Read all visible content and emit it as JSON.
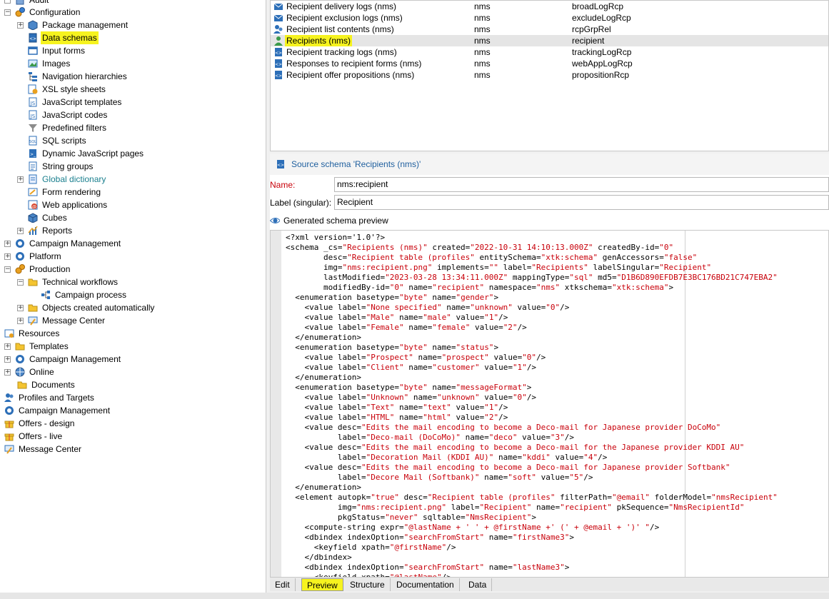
{
  "tree": {
    "items": [
      {
        "label": "Audit",
        "icon": "audit-icon"
      },
      {
        "label": "Configuration",
        "icon": "gears-icon"
      },
      {
        "label": "Package management",
        "icon": "package-icon"
      },
      {
        "label": "Data schemas",
        "icon": "schema-icon"
      },
      {
        "label": "Input forms",
        "icon": "form-icon"
      },
      {
        "label": "Images",
        "icon": "image-icon"
      },
      {
        "label": "Navigation hierarchies",
        "icon": "hierarchy-icon"
      },
      {
        "label": "XSL style sheets",
        "icon": "xsl-icon"
      },
      {
        "label": "JavaScript templates",
        "icon": "js-template-icon"
      },
      {
        "label": "JavaScript codes",
        "icon": "js-code-icon"
      },
      {
        "label": "Predefined filters",
        "icon": "filter-icon"
      },
      {
        "label": "SQL scripts",
        "icon": "sql-icon"
      },
      {
        "label": "Dynamic JavaScript pages",
        "icon": "js-page-icon"
      },
      {
        "label": "String groups",
        "icon": "string-group-icon"
      },
      {
        "label": "Global dictionary",
        "icon": "dictionary-icon"
      },
      {
        "label": "Form rendering",
        "icon": "form-rendering-icon"
      },
      {
        "label": "Web applications",
        "icon": "web-app-icon"
      },
      {
        "label": "Cubes",
        "icon": "cube-icon"
      },
      {
        "label": "Reports",
        "icon": "report-icon"
      },
      {
        "label": "Campaign Management",
        "icon": "campaign-icon"
      },
      {
        "label": "Platform",
        "icon": "platform-icon"
      },
      {
        "label": "Production",
        "icon": "production-icon"
      },
      {
        "label": "Technical workflows",
        "icon": "folder-icon"
      },
      {
        "label": "Campaign process",
        "icon": "workflow-icon"
      },
      {
        "label": "Objects created automatically",
        "icon": "folder-icon"
      },
      {
        "label": "Message Center",
        "icon": "message-center-icon"
      },
      {
        "label": "Resources",
        "icon": "resources-icon"
      },
      {
        "label": "Templates",
        "icon": "folder-icon"
      },
      {
        "label": "Campaign Management",
        "icon": "campaign-icon"
      },
      {
        "label": "Online",
        "icon": "online-icon"
      },
      {
        "label": "Documents",
        "icon": "documents-icon"
      },
      {
        "label": "Profiles and Targets",
        "icon": "profiles-icon"
      },
      {
        "label": "Campaign Management",
        "icon": "campaign-icon"
      },
      {
        "label": "Offers - design",
        "icon": "offer-icon"
      },
      {
        "label": "Offers - live",
        "icon": "offer-icon"
      },
      {
        "label": "Message Center",
        "icon": "message-center-icon"
      }
    ]
  },
  "list": {
    "rows": [
      {
        "name": "Recipient delivery logs (nms)",
        "ns": "nms",
        "internal": "broadLogRcp",
        "icon": "delivery-log-icon"
      },
      {
        "name": "Recipient exclusion logs (nms)",
        "ns": "nms",
        "internal": "excludeLogRcp",
        "icon": "exclusion-log-icon"
      },
      {
        "name": "Recipient list contents (nms)",
        "ns": "nms",
        "internal": "rcpGrpRel",
        "icon": "list-content-icon"
      },
      {
        "name": "Recipients (nms)",
        "ns": "nms",
        "internal": "recipient",
        "icon": "recipient-icon"
      },
      {
        "name": "Recipient tracking logs (nms)",
        "ns": "nms",
        "internal": "trackingLogRcp",
        "icon": "schema-icon"
      },
      {
        "name": "Responses to recipient forms (nms)",
        "ns": "nms",
        "internal": "webAppLogRcp",
        "icon": "schema-icon"
      },
      {
        "name": "Recipient offer propositions (nms)",
        "ns": "nms",
        "internal": "propositionRcp",
        "icon": "schema-icon"
      }
    ]
  },
  "source": {
    "header": "Source schema 'Recipients (nms)'",
    "name_label": "Name:",
    "name_value": "nms:recipient",
    "label_label": "Label (singular):",
    "label_value": "Recipient",
    "preview_label": "Generated schema preview"
  },
  "code_lines": [
    [
      [
        "pi",
        "<?xml version='1.0'?>"
      ]
    ],
    [
      [
        "t",
        "<schema "
      ],
      [
        "a",
        "_cs="
      ],
      [
        "v",
        "\"Recipients (nms)\""
      ],
      [
        "a",
        " created="
      ],
      [
        "v",
        "\"2022-10-31 14:10:13.000Z\""
      ],
      [
        "a",
        " createdBy-id="
      ],
      [
        "v",
        "\"0\""
      ]
    ],
    [
      [
        "a",
        "        desc="
      ],
      [
        "v",
        "\"Recipient table (profiles\""
      ],
      [
        "a",
        " entitySchema="
      ],
      [
        "v",
        "\"xtk:schema\""
      ],
      [
        "a",
        " genAccessors="
      ],
      [
        "v",
        "\"false\""
      ]
    ],
    [
      [
        "a",
        "        img="
      ],
      [
        "v",
        "\"nms:recipient.png\""
      ],
      [
        "a",
        " implements="
      ],
      [
        "v",
        "\"\""
      ],
      [
        "a",
        " label="
      ],
      [
        "v",
        "\"Recipients\""
      ],
      [
        "a",
        " labelSingular="
      ],
      [
        "v",
        "\"Recipient\""
      ]
    ],
    [
      [
        "a",
        "        lastModified="
      ],
      [
        "v",
        "\"2023-03-28 13:34:11.000Z\""
      ],
      [
        "a",
        " mappingType="
      ],
      [
        "v",
        "\"sql\""
      ],
      [
        "a",
        " md5="
      ],
      [
        "v",
        "\"D1B6D890EFDB7E3BC176BD21C747EBA2\""
      ]
    ],
    [
      [
        "a",
        "        modifiedBy-id="
      ],
      [
        "v",
        "\"0\""
      ],
      [
        "a",
        " name="
      ],
      [
        "v",
        "\"recipient\""
      ],
      [
        "a",
        " namespace="
      ],
      [
        "v",
        "\"nms\""
      ],
      [
        "a",
        " xtkschema="
      ],
      [
        "v",
        "\"xtk:schema\""
      ],
      [
        "t",
        ">"
      ]
    ],
    [
      [
        "t",
        "  <enumeration "
      ],
      [
        "a",
        "basetype="
      ],
      [
        "v",
        "\"byte\""
      ],
      [
        "a",
        " name="
      ],
      [
        "v",
        "\"gender\""
      ],
      [
        "t",
        ">"
      ]
    ],
    [
      [
        "t",
        "    <value "
      ],
      [
        "a",
        "label="
      ],
      [
        "v",
        "\"None specified\""
      ],
      [
        "a",
        " name="
      ],
      [
        "v",
        "\"unknown\""
      ],
      [
        "a",
        " value="
      ],
      [
        "v",
        "\"0\""
      ],
      [
        "t",
        "/>"
      ]
    ],
    [
      [
        "t",
        "    <value "
      ],
      [
        "a",
        "label="
      ],
      [
        "v",
        "\"Male\""
      ],
      [
        "a",
        " name="
      ],
      [
        "v",
        "\"male\""
      ],
      [
        "a",
        " value="
      ],
      [
        "v",
        "\"1\""
      ],
      [
        "t",
        "/>"
      ]
    ],
    [
      [
        "t",
        "    <value "
      ],
      [
        "a",
        "label="
      ],
      [
        "v",
        "\"Female\""
      ],
      [
        "a",
        " name="
      ],
      [
        "v",
        "\"female\""
      ],
      [
        "a",
        " value="
      ],
      [
        "v",
        "\"2\""
      ],
      [
        "t",
        "/>"
      ]
    ],
    [
      [
        "t",
        "  </enumeration>"
      ]
    ],
    [
      [
        "t",
        "  <enumeration "
      ],
      [
        "a",
        "basetype="
      ],
      [
        "v",
        "\"byte\""
      ],
      [
        "a",
        " name="
      ],
      [
        "v",
        "\"status\""
      ],
      [
        "t",
        ">"
      ]
    ],
    [
      [
        "t",
        "    <value "
      ],
      [
        "a",
        "label="
      ],
      [
        "v",
        "\"Prospect\""
      ],
      [
        "a",
        " name="
      ],
      [
        "v",
        "\"prospect\""
      ],
      [
        "a",
        " value="
      ],
      [
        "v",
        "\"0\""
      ],
      [
        "t",
        "/>"
      ]
    ],
    [
      [
        "t",
        "    <value "
      ],
      [
        "a",
        "label="
      ],
      [
        "v",
        "\"Client\""
      ],
      [
        "a",
        " name="
      ],
      [
        "v",
        "\"customer\""
      ],
      [
        "a",
        " value="
      ],
      [
        "v",
        "\"1\""
      ],
      [
        "t",
        "/>"
      ]
    ],
    [
      [
        "t",
        "  </enumeration>"
      ]
    ],
    [
      [
        "t",
        "  <enumeration "
      ],
      [
        "a",
        "basetype="
      ],
      [
        "v",
        "\"byte\""
      ],
      [
        "a",
        " name="
      ],
      [
        "v",
        "\"messageFormat\""
      ],
      [
        "t",
        ">"
      ]
    ],
    [
      [
        "t",
        "    <value "
      ],
      [
        "a",
        "label="
      ],
      [
        "v",
        "\"Unknown\""
      ],
      [
        "a",
        " name="
      ],
      [
        "v",
        "\"unknown\""
      ],
      [
        "a",
        " value="
      ],
      [
        "v",
        "\"0\""
      ],
      [
        "t",
        "/>"
      ]
    ],
    [
      [
        "t",
        "    <value "
      ],
      [
        "a",
        "label="
      ],
      [
        "v",
        "\"Text\""
      ],
      [
        "a",
        " name="
      ],
      [
        "v",
        "\"text\""
      ],
      [
        "a",
        " value="
      ],
      [
        "v",
        "\"1\""
      ],
      [
        "t",
        "/>"
      ]
    ],
    [
      [
        "t",
        "    <value "
      ],
      [
        "a",
        "label="
      ],
      [
        "v",
        "\"HTML\""
      ],
      [
        "a",
        " name="
      ],
      [
        "v",
        "\"html\""
      ],
      [
        "a",
        " value="
      ],
      [
        "v",
        "\"2\""
      ],
      [
        "t",
        "/>"
      ]
    ],
    [
      [
        "t",
        "    <value "
      ],
      [
        "a",
        "desc="
      ],
      [
        "v",
        "\"Edits the mail encoding to become a Deco-mail for Japanese provider DoCoMo\""
      ]
    ],
    [
      [
        "a",
        "           label="
      ],
      [
        "v",
        "\"Deco-mail (DoCoMo)\""
      ],
      [
        "a",
        " name="
      ],
      [
        "v",
        "\"deco\""
      ],
      [
        "a",
        " value="
      ],
      [
        "v",
        "\"3\""
      ],
      [
        "t",
        "/>"
      ]
    ],
    [
      [
        "t",
        "    <value "
      ],
      [
        "a",
        "desc="
      ],
      [
        "v",
        "\"Edits the mail encoding to become a Deco-mail for the Japanese provider KDDI AU\""
      ]
    ],
    [
      [
        "a",
        "           label="
      ],
      [
        "v",
        "\"Decoration Mail (KDDI AU)\""
      ],
      [
        "a",
        " name="
      ],
      [
        "v",
        "\"kddi\""
      ],
      [
        "a",
        " value="
      ],
      [
        "v",
        "\"4\""
      ],
      [
        "t",
        "/>"
      ]
    ],
    [
      [
        "t",
        "    <value "
      ],
      [
        "a",
        "desc="
      ],
      [
        "v",
        "\"Edits the mail encoding to become a Deco-mail for Japanese provider Softbank\""
      ]
    ],
    [
      [
        "a",
        "           label="
      ],
      [
        "v",
        "\"Decore Mail (Softbank)\""
      ],
      [
        "a",
        " name="
      ],
      [
        "v",
        "\"soft\""
      ],
      [
        "a",
        " value="
      ],
      [
        "v",
        "\"5\""
      ],
      [
        "t",
        "/>"
      ]
    ],
    [
      [
        "t",
        "  </enumeration>"
      ]
    ],
    [
      [
        "t",
        "  <element "
      ],
      [
        "a",
        "autopk="
      ],
      [
        "v",
        "\"true\""
      ],
      [
        "a",
        " desc="
      ],
      [
        "v",
        "\"Recipient table (profiles\""
      ],
      [
        "a",
        " filterPath="
      ],
      [
        "v",
        "\"@email\""
      ],
      [
        "a",
        " folderModel="
      ],
      [
        "v",
        "\"nmsRecipient\""
      ]
    ],
    [
      [
        "a",
        "           img="
      ],
      [
        "v",
        "\"nms:recipient.png\""
      ],
      [
        "a",
        " label="
      ],
      [
        "v",
        "\"Recipient\""
      ],
      [
        "a",
        " name="
      ],
      [
        "v",
        "\"recipient\""
      ],
      [
        "a",
        " pkSequence="
      ],
      [
        "v",
        "\"NmsRecipientId\""
      ]
    ],
    [
      [
        "a",
        "           pkgStatus="
      ],
      [
        "v",
        "\"never\""
      ],
      [
        "a",
        " sqltable="
      ],
      [
        "v",
        "\"NmsRecipient\""
      ],
      [
        "t",
        ">"
      ]
    ],
    [
      [
        "t",
        "    <compute-string "
      ],
      [
        "a",
        "expr="
      ],
      [
        "v",
        "\"@lastName + ' ' + @firstName +' (' + @email + ')' \""
      ],
      [
        "t",
        "/>"
      ]
    ],
    [
      [
        "t",
        "    <dbindex "
      ],
      [
        "a",
        "indexOption="
      ],
      [
        "v",
        "\"searchFromStart\""
      ],
      [
        "a",
        " name="
      ],
      [
        "v",
        "\"firstName3\""
      ],
      [
        "t",
        ">"
      ]
    ],
    [
      [
        "t",
        "      <keyfield "
      ],
      [
        "a",
        "xpath="
      ],
      [
        "v",
        "\"@firstName\""
      ],
      [
        "t",
        "/>"
      ]
    ],
    [
      [
        "t",
        "    </dbindex>"
      ]
    ],
    [
      [
        "t",
        "    <dbindex "
      ],
      [
        "a",
        "indexOption="
      ],
      [
        "v",
        "\"searchFromStart\""
      ],
      [
        "a",
        " name="
      ],
      [
        "v",
        "\"lastName3\""
      ],
      [
        "t",
        ">"
      ]
    ],
    [
      [
        "t",
        "      <keyfield "
      ],
      [
        "a",
        "xpath="
      ],
      [
        "v",
        "\"@lastName\""
      ],
      [
        "t",
        "/>"
      ]
    ]
  ],
  "tabs": [
    "Edit",
    "Preview",
    "Structure",
    "Documentation",
    "Data"
  ],
  "colors": {
    "highlight": "#f6f31f",
    "value_red": "#c8000a",
    "link_blue": "#1f5f9e"
  }
}
